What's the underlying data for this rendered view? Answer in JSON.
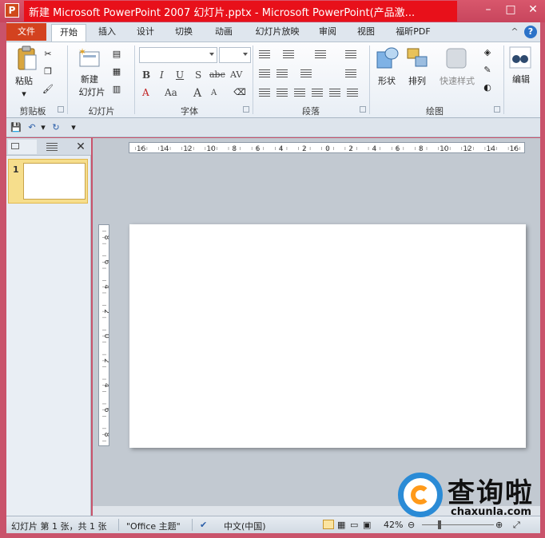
{
  "window": {
    "title": "新建 Microsoft PowerPoint 2007 幻灯片.pptx - Microsoft PowerPoint(产品激...",
    "app_icon": "powerpoint-icon",
    "buttons": {
      "minimize": "–",
      "maximize": "□",
      "close": "✕"
    }
  },
  "tabs": {
    "file": "文件",
    "items": [
      "开始",
      "插入",
      "设计",
      "切换",
      "动画",
      "幻灯片放映",
      "审阅",
      "视图",
      "福昕PDF"
    ],
    "active": "开始",
    "help": "?"
  },
  "ribbon": {
    "clipboard": {
      "paste": "粘贴",
      "group_label": "剪贴板"
    },
    "slides": {
      "new_slide_line1": "新建",
      "new_slide_line2": "幻灯片",
      "group_label": "幻灯片"
    },
    "font": {
      "font_name_value": "",
      "font_size_value": "",
      "bold": "B",
      "italic": "I",
      "underline": "U",
      "strike": "S",
      "abc": "abc",
      "av": "AV",
      "font_color": "A",
      "case": "Aa",
      "grow": "A",
      "shrink": "A",
      "group_label": "字体"
    },
    "paragraph": {
      "group_label": "段落"
    },
    "drawing": {
      "shapes": "形状",
      "arrange": "排列",
      "quick_styles": "快速样式",
      "group_label": "绘图"
    },
    "editing": {
      "label": "编辑"
    }
  },
  "qat": {
    "icons": [
      "save-icon",
      "undo-icon",
      "redo-icon",
      "customize-qat-icon"
    ]
  },
  "slides_panel": {
    "slide_number": "1",
    "close": "✕"
  },
  "rulers": {
    "horizontal_labels": [
      "16",
      "14",
      "12",
      "10",
      "8",
      "6",
      "4",
      "2",
      "0",
      "2",
      "4",
      "6",
      "8",
      "10",
      "12",
      "14",
      "16"
    ],
    "vertical_labels": [
      "8",
      "6",
      "4",
      "2",
      "0",
      "2",
      "4",
      "6",
      "8"
    ]
  },
  "statusbar": {
    "slide_info": "幻灯片 第 1 张，共 1 张",
    "theme": "\"Office 主题\"",
    "language": "中文(中国)",
    "zoom": "42%"
  },
  "watermark": {
    "title": "查询啦",
    "url": "chaxunla.com"
  },
  "colors": {
    "title_bar": "#c8455d",
    "title_highlight": "#e8101a",
    "file_tab": "#d3421f",
    "slide_selected": "#f6de8c",
    "watermark_blue": "#2a8bd6",
    "watermark_orange": "#ff9a1a"
  }
}
